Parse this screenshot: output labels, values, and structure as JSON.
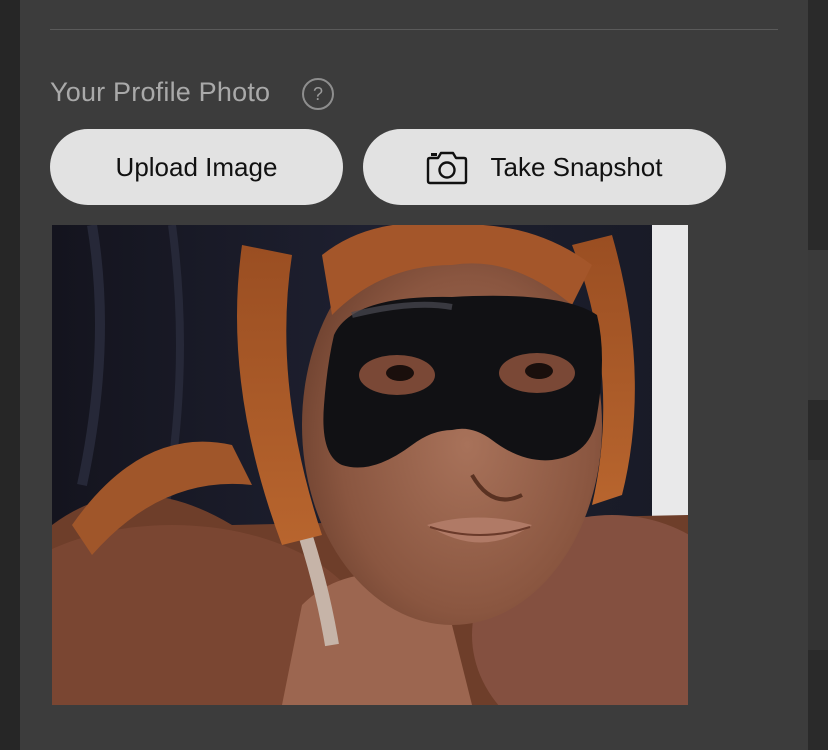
{
  "profile_photo": {
    "title": "Your Profile Photo",
    "help_glyph": "?",
    "help_icon": "question-circle-icon"
  },
  "actions": {
    "upload_label": "Upload Image",
    "snapshot_label": "Take Snapshot",
    "snapshot_icon": "camera-icon"
  },
  "colors": {
    "panel_background": "#3c3c3c",
    "button_background": "#e2e2e2",
    "title_text": "#a9a9a9"
  }
}
